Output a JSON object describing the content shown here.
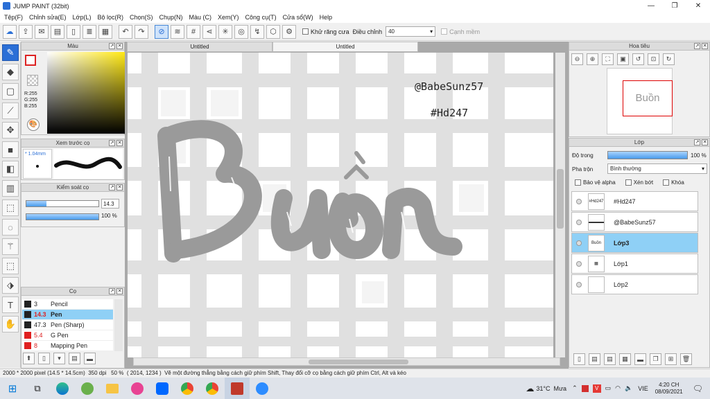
{
  "window": {
    "title": "JUMP PAINT (32bit)",
    "controls": [
      "—",
      "❐",
      "✕"
    ]
  },
  "menu": [
    "Tệp(F)",
    "Chỉnh sửa(E)",
    "Lớp(L)",
    "Bộ lọc(R)",
    "Chọn(S)",
    "Chụp(N)",
    "Màu (C)",
    "Xem(Y)",
    "Công cụ(T)",
    "Cửa sổ(W)",
    "Help"
  ],
  "toolbar": {
    "antialias_label": "Khử răng cưa",
    "adjust_label": "Điều chỉnh",
    "adjust_value": "40",
    "edge_label": "Cạnh mềm"
  },
  "color_panel": {
    "title": "Màu",
    "r": "R:255",
    "g": "G:255",
    "b": "B:255"
  },
  "brush_preview": {
    "title": "Xem trước cọ",
    "size": "* 1.04mm"
  },
  "brush_control": {
    "title": "Kiểm soát cọ",
    "size_value": "14.3",
    "opacity_value": "100 %"
  },
  "brush_list": {
    "title": "Cọ",
    "items": [
      {
        "size": "3",
        "name": "Pencil",
        "swatch": "#222222",
        "selected": false
      },
      {
        "size": "14.3",
        "name": "Pen",
        "swatch": "#222222",
        "selected": true
      },
      {
        "size": "47.3",
        "name": "Pen (Sharp)",
        "swatch": "#222222",
        "selected": false
      },
      {
        "size": "5.4",
        "name": "G Pen",
        "swatch": "#e02020",
        "selected": false
      },
      {
        "size": "8",
        "name": "Mapping Pen",
        "swatch": "#e02020",
        "selected": false
      }
    ]
  },
  "tabs": [
    "Untitled",
    "Untitled"
  ],
  "canvas": {
    "handle": "@BabeSunz57",
    "tag": "#Hd247",
    "word": "Buồn"
  },
  "navigator": {
    "title": "Hoa tiêu"
  },
  "layers": {
    "title": "Lớp",
    "opacity_label": "Độ trong",
    "opacity_value": "100 %",
    "blend_label": "Pha trộn",
    "blend_value": "Bình thường",
    "alpha_label": "Bảo vệ alpha",
    "clip_label": "Xén bớt",
    "lock_label": "Khóa",
    "items": [
      {
        "name": "#Hd247",
        "thumb": "#Hd247",
        "selected": false
      },
      {
        "name": "@BabeSunz57",
        "thumb": "▬▬▬▬",
        "selected": false
      },
      {
        "name": "Lớp3",
        "thumb": "Buồn",
        "selected": true
      },
      {
        "name": "Lớp1",
        "thumb": "▦",
        "selected": false
      },
      {
        "name": "Lớp2",
        "thumb": "",
        "selected": false
      }
    ]
  },
  "status": {
    "size": "2000 * 2000 pixel",
    "physical": "(14.5 * 14.5cm)",
    "dpi": "350 dpi",
    "zoom": "50 %",
    "coords": "( 2014, 1234 )",
    "hint": "Vẽ một đường thẳng bằng cách giữ phím Shift, Thay đổi cỡ cọ bằng cách giữ phím Ctrl, Alt và kéo"
  },
  "taskbar": {
    "temperature": "31°C",
    "weather": "Mưa",
    "language": "VIE",
    "time": "4:20 CH",
    "date": "08/09/2021"
  },
  "colors": {
    "accent": "#2b6fd6",
    "layer_selected": "#8fd0f6",
    "canvas_stroke": "#9a9a9a"
  }
}
